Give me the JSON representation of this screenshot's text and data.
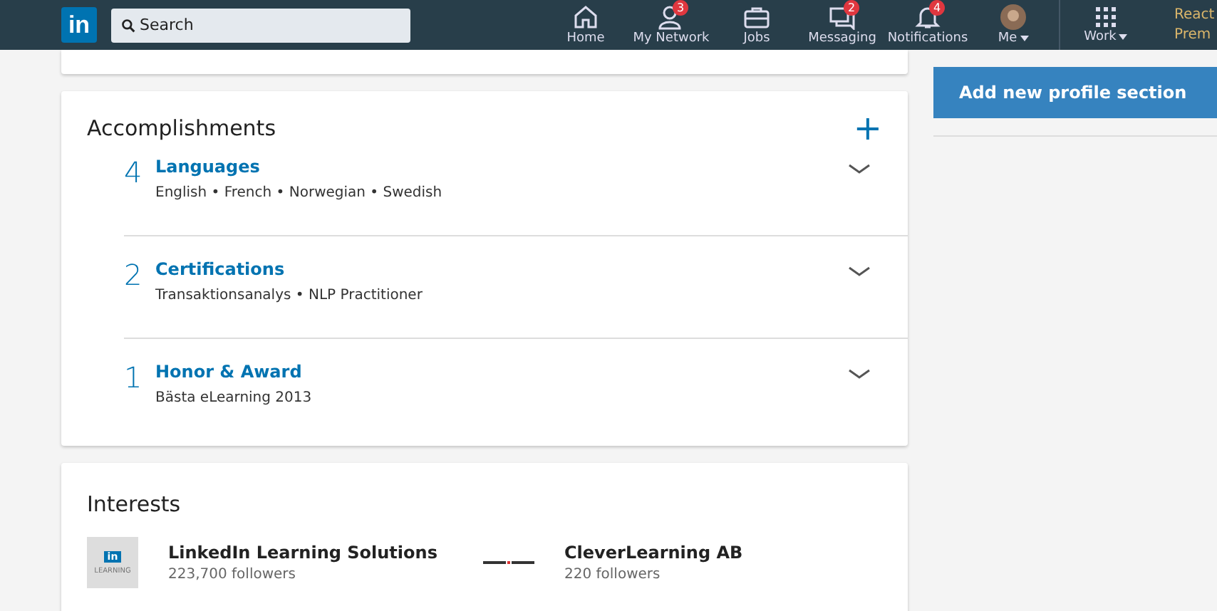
{
  "navbar": {
    "logo": "in",
    "search": {
      "placeholder": "Search"
    },
    "items": [
      {
        "kind": "home",
        "label": "Home"
      },
      {
        "kind": "network",
        "label": "My Network",
        "badge": "3"
      },
      {
        "kind": "jobs",
        "label": "Jobs"
      },
      {
        "kind": "messaging",
        "label": "Messaging",
        "badge": "2"
      },
      {
        "kind": "notifications",
        "label": "Notifications",
        "badge": "4"
      },
      {
        "kind": "me",
        "label": "Me"
      },
      {
        "kind": "work",
        "label": "Work"
      }
    ],
    "promo": [
      "React",
      "Prem"
    ]
  },
  "accomplishments": {
    "title": "Accomplishments",
    "add": "+",
    "items": [
      {
        "count": "4",
        "title": "Languages",
        "detail": "English • French • Norwegian • Swedish"
      },
      {
        "count": "2",
        "title": "Certifications",
        "detail": "Transaktionsanalys • NLP Practitioner"
      },
      {
        "count": "1",
        "title": "Honor & Award",
        "detail": "Bästa eLearning 2013"
      }
    ]
  },
  "interests": {
    "title": "Interests",
    "items": [
      {
        "kind": "linkedin",
        "logo_mark": "in",
        "logo_text": "LEARNING",
        "name": "LinkedIn Learning Solutions",
        "followers": "223,700 followers"
      },
      {
        "kind": "clever",
        "name": "CleverLearning AB",
        "followers": "220 followers"
      }
    ]
  },
  "sidebar": {
    "button": "Add new profile section"
  }
}
